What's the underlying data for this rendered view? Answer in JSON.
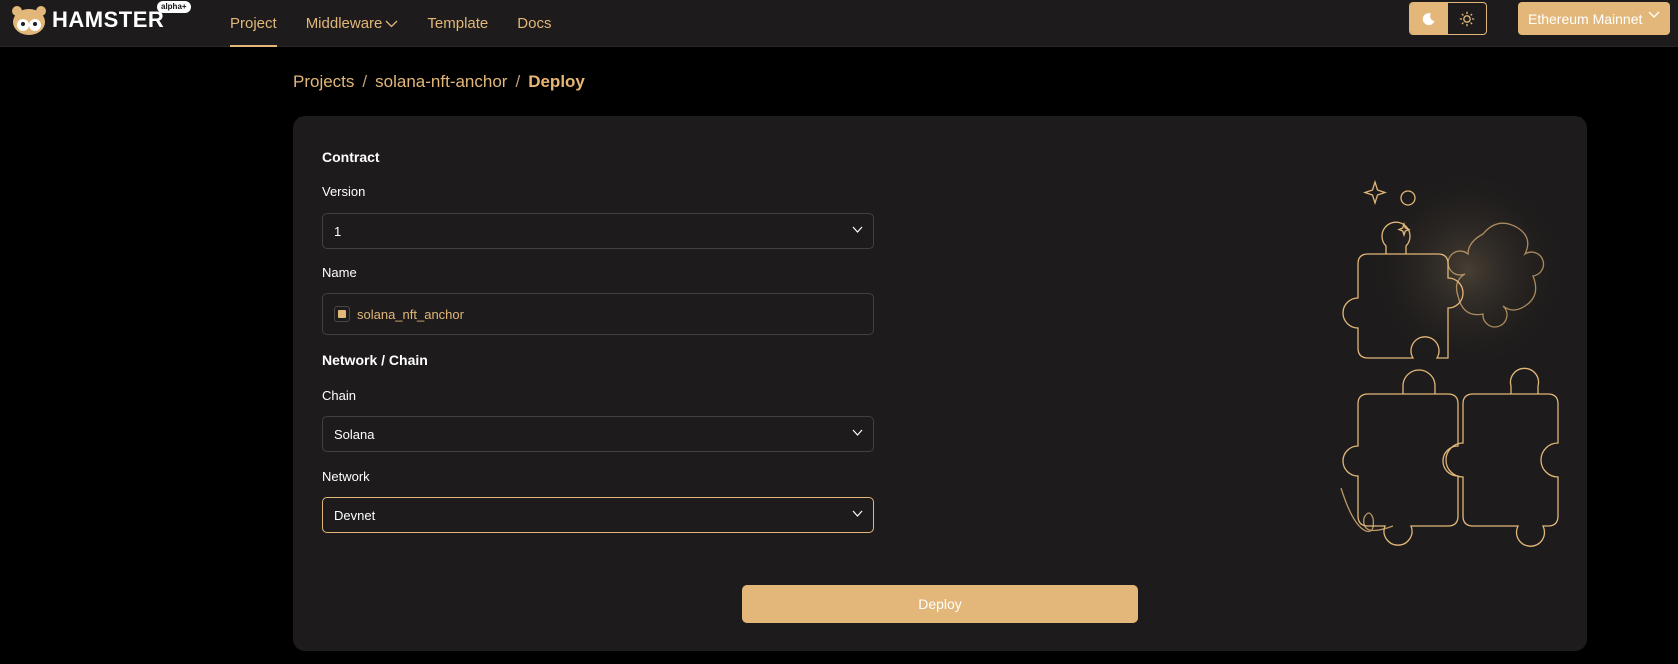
{
  "header": {
    "logo_text": "HAMSTER",
    "logo_badge": "alpha+",
    "nav": [
      {
        "label": "Project",
        "active": true
      },
      {
        "label": "Middleware",
        "has_dropdown": true
      },
      {
        "label": "Template"
      },
      {
        "label": "Docs"
      }
    ],
    "theme": {
      "dark_icon": "moon-icon",
      "light_icon": "sun-icon",
      "selected": "dark"
    },
    "network_select": "Ethereum Mainnet"
  },
  "breadcrumb": {
    "items": [
      "Projects",
      "solana-nft-anchor"
    ],
    "current": "Deploy",
    "separator": "/"
  },
  "form": {
    "contract_title": "Contract",
    "version_label": "Version",
    "version_value": "1",
    "name_label": "Name",
    "name_value": "solana_nft_anchor",
    "network_title": "Network / Chain",
    "chain_label": "Chain",
    "chain_value": "Solana",
    "network_label": "Network",
    "network_value": "Devnet",
    "deploy_label": "Deploy"
  },
  "colors": {
    "accent": "#e2b779",
    "background": "#000000",
    "card": "#1d1b1b",
    "border": "#434040"
  }
}
